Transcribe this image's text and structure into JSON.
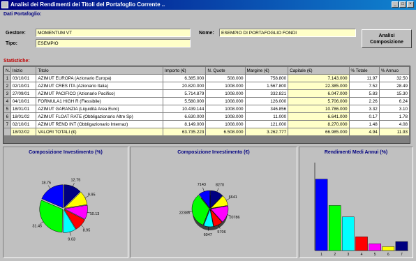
{
  "window": {
    "title": "Analisi dei Rendimenti dei Titoli del Portafoglio Corrente ..",
    "buttons": [
      "_",
      "□",
      "×"
    ]
  },
  "portfolio": {
    "section_label": "Dati Portafoglio:",
    "gestore_label": "Gestore:",
    "gestore_value": "MOMENTUM VT",
    "tipo_label": "Tipo:",
    "tipo_value": "ESEMPIO",
    "nome_label": "Nome:",
    "nome_value": "ESEMPIO DI PORTAFOGLIO FONDI",
    "analyze_button": "Analisi\nComposizione"
  },
  "stats": {
    "section_label": "Statistiche:",
    "columns": [
      "N.",
      "Inizio",
      "Titolo",
      "Importo (€)",
      "N. Quote",
      "Margine (€)",
      "Capitale (€)",
      "% Totale",
      "% Annuo"
    ],
    "rows": [
      [
        "1",
        "03/10/01",
        "AZIMUT EUROPA      (Azionario Europa)",
        "6.385.000",
        "508.000",
        "758.800",
        "7.143.000",
        "11.97",
        "32.50"
      ],
      [
        "2",
        "02/10/01",
        "AZIMUT CRES ITA      (Azionario Italia)",
        "20.820.000",
        "1008.000",
        "1.567.800",
        "22.385.000",
        "7.52",
        "28.49"
      ],
      [
        "3",
        "27/09/01",
        "AZIMUT PACIFICO      (Azionario Pacifico)",
        "5.714.879",
        "1008.000",
        "332.821",
        "6.047.000",
        "5.83",
        "15.30"
      ],
      [
        "4",
        "04/10/01",
        "FORMULA1 HIGH R      (Flessibile)",
        "5.580.000",
        "1008.000",
        "126.000",
        "5.706.000",
        "2.26",
        "6.24"
      ],
      [
        "5",
        "18/01/01",
        "AZIMUT GARANZIA      (Liquidità Area Euro)",
        "10.439.144",
        "1008.000",
        "346.856",
        "10.786.000",
        "3.32",
        "3.10"
      ],
      [
        "6",
        "18/01/02",
        "AZIMUT FLOAT RATE      (Obbligazionario Altre Sp)",
        "6.630.000",
        "1008.000",
        "11.000",
        "6.641.000",
        "0.17",
        "1.78"
      ],
      [
        "7",
        "02/10/01",
        "AZIMUT REND INT      (Obbligazionario Internaz)",
        "8.149.000",
        "1008.000",
        "121.000",
        "8.270.000",
        "1.48",
        "4.08"
      ]
    ],
    "total": [
      "",
      "18/02/02",
      "VALORI TOTALI (€)",
      "63.735.223",
      "6.508.000",
      "3.262.777",
      "66.985.000",
      "4.94",
      "11.93"
    ]
  },
  "charts": [
    {
      "title": "Composizione Investimento (%)",
      "chart_data": {
        "type": "pie",
        "labels": [
          "12.75",
          "9.95",
          "10.13",
          "8.95",
          "9.03",
          "31.45",
          "18.75"
        ],
        "values": [
          12.75,
          9.95,
          10.13,
          8.95,
          9.03,
          31.45,
          18.75
        ],
        "colors": [
          "#000080",
          "#ffff00",
          "#ff00ff",
          "#ff0000",
          "#00ffff",
          "#00ff00",
          "#0000ff"
        ]
      }
    },
    {
      "title": "Composizione Investimento (€)",
      "chart_data": {
        "type": "pie",
        "labels": [
          "8270",
          "6641",
          "10786",
          "5706",
          "6047",
          "22385",
          "7143"
        ],
        "values": [
          8270,
          6641,
          10786,
          5706,
          6047,
          22385,
          7143
        ],
        "colors": [
          "#000080",
          "#ffff00",
          "#ff00ff",
          "#ff0000",
          "#00ffff",
          "#00ff00",
          "#0000ff"
        ]
      }
    },
    {
      "title": "Rendimenti Medi Annui (%)",
      "chart_data": {
        "type": "bar",
        "categories": [
          "1",
          "2",
          "3",
          "4",
          "5",
          "6",
          "7"
        ],
        "values": [
          32.5,
          20.5,
          15.3,
          6.24,
          3.1,
          1.78,
          4.08
        ],
        "colors": [
          "#0000ff",
          "#00ff00",
          "#00ffff",
          "#ff0000",
          "#ff00ff",
          "#ffff00",
          "#000080"
        ],
        "ylim": [
          0,
          40
        ]
      }
    }
  ]
}
